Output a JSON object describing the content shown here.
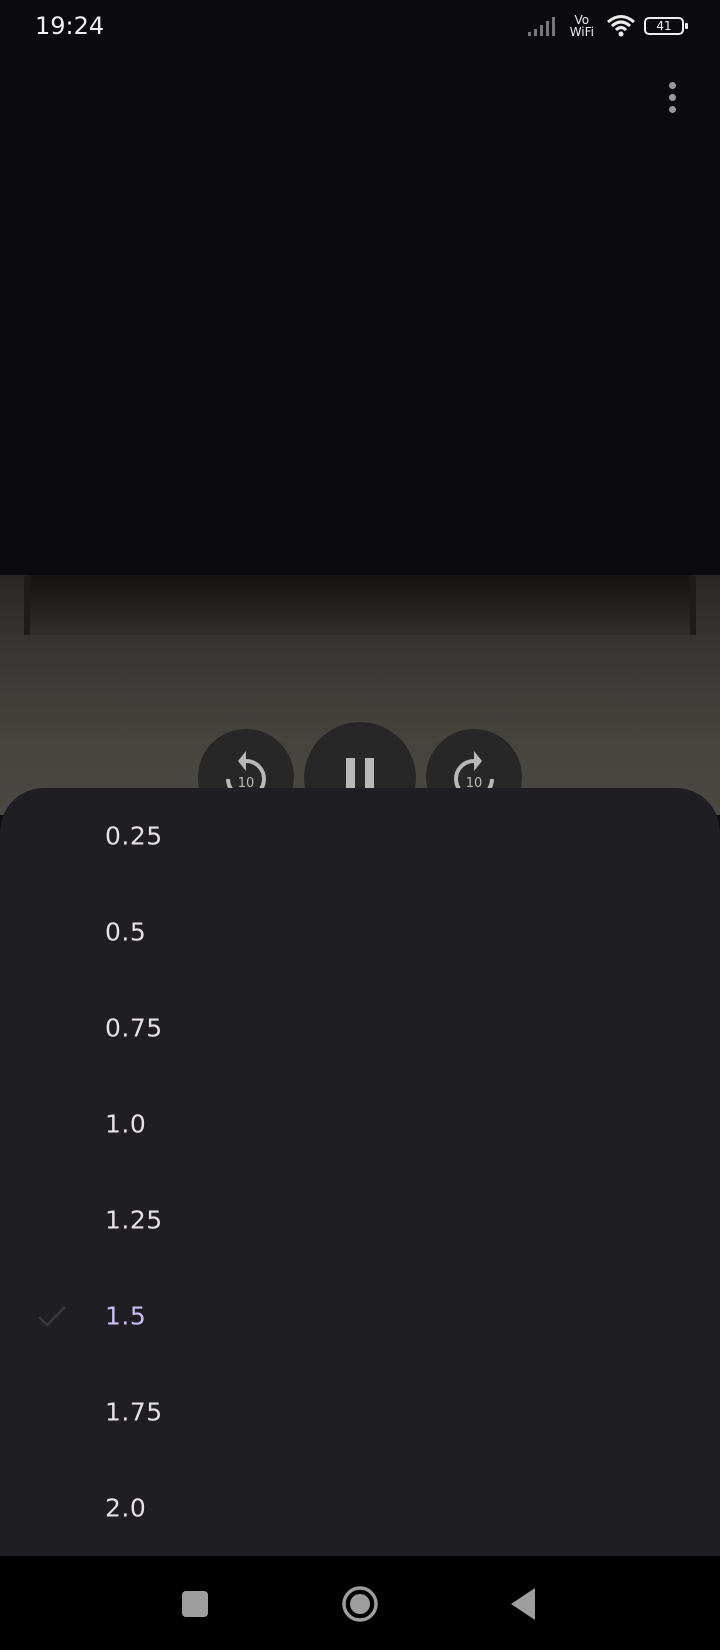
{
  "status_bar": {
    "time": "19:24",
    "vowifi_top": "Vo",
    "vowifi_bottom": "WiFi",
    "battery": "41"
  },
  "player": {
    "menu_icon": "more-vert-icon",
    "rewind_icon": "replay-10-icon",
    "rewind_seconds": "10",
    "pause_icon": "pause-icon",
    "forward_icon": "forward-10-icon",
    "forward_seconds": "10"
  },
  "speed_sheet": {
    "options": [
      "0.25",
      "0.5",
      "0.75",
      "1.0",
      "1.25",
      "1.5",
      "1.75",
      "2.0"
    ],
    "selected": "1.5",
    "selected_color": "#cbbef5",
    "check_icon": "check-icon"
  },
  "nav_bar": {
    "recents_icon": "recents-square-icon",
    "home_icon": "home-circle-icon",
    "back_icon": "back-triangle-icon"
  }
}
